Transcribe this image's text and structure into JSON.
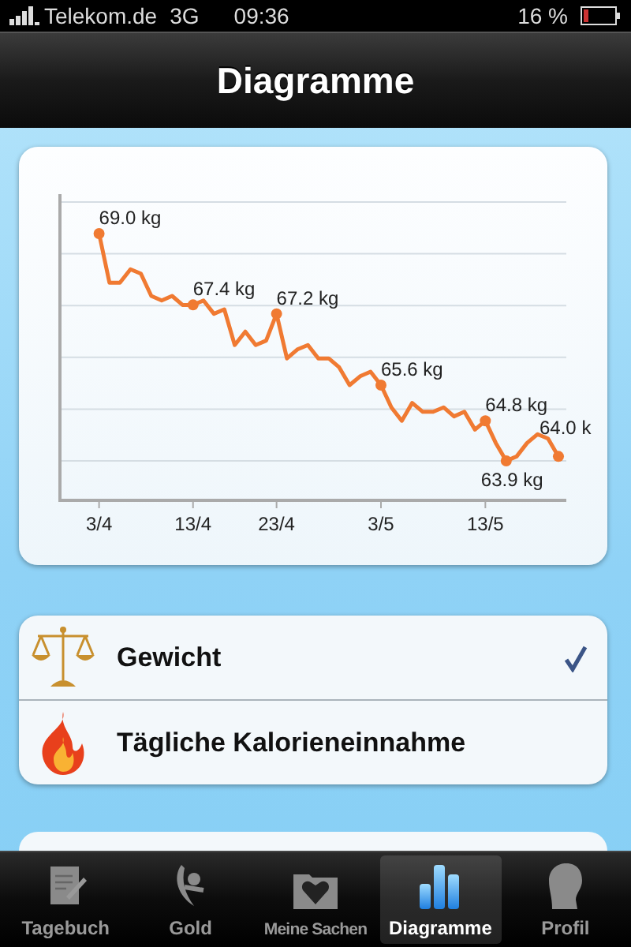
{
  "status_bar": {
    "carrier": "Telekom.de",
    "network": "3G",
    "time": "09:36",
    "battery": "16 %"
  },
  "nav_bar": {
    "title": "Diagramme"
  },
  "chart": {
    "x_labels": [
      "3/4",
      "13/4",
      "23/4",
      "3/5",
      "13/5"
    ],
    "point_labels": [
      "69.0 kg",
      "67.4 kg",
      "67.2 kg",
      "65.6 kg",
      "64.8 kg",
      "63.9 kg",
      "64.0 k"
    ]
  },
  "chart_list": {
    "items": [
      {
        "label": "Gewicht",
        "checked": true
      },
      {
        "label": "Tägliche Kalorieneinnahme",
        "checked": false
      }
    ]
  },
  "tab_bar": {
    "tabs": [
      {
        "label": "Tagebuch",
        "selected": false
      },
      {
        "label": "Gold",
        "selected": false
      },
      {
        "label": "Meine Sachen",
        "selected": false
      },
      {
        "label": "Diagramme",
        "selected": true
      },
      {
        "label": "Profil",
        "selected": false
      }
    ]
  }
}
